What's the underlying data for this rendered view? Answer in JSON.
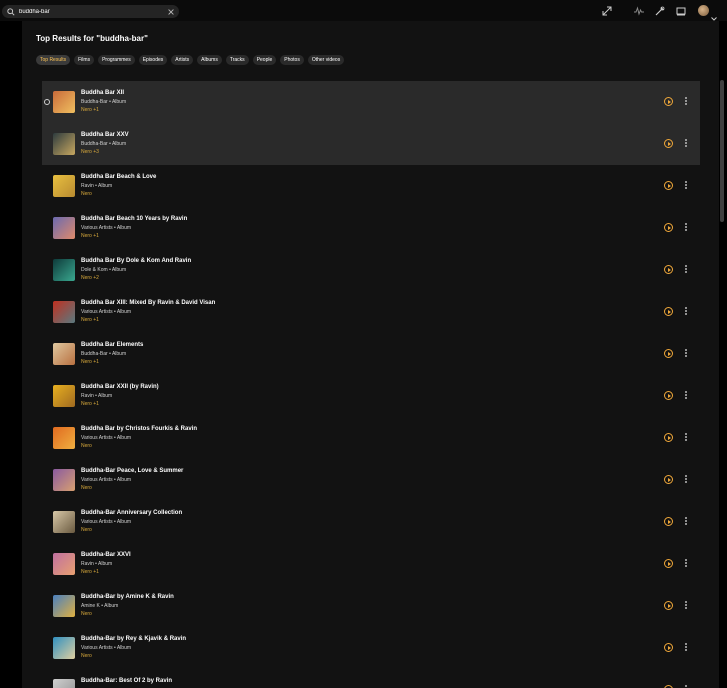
{
  "search": {
    "value": "buddha-bar"
  },
  "heading": "Top Results for \"buddha-bar\"",
  "filters": [
    "Top Results",
    "Films",
    "Programmes",
    "Episodes",
    "Artists",
    "Albums",
    "Tracks",
    "People",
    "Photos",
    "Other videos"
  ],
  "active_filter": "Top Results",
  "colors": {
    "accent": "#f0a83a",
    "meta": "#d8a93c",
    "background": "#121212",
    "highlight": "#2a2a2a"
  },
  "icons": {
    "search": "search-icon",
    "clear": "clear-icon",
    "expand": "expand-icon",
    "activity": "activity-icon",
    "tools": "tools-icon",
    "cast": "cast-icon",
    "play": "play-icon",
    "more": "more-icon"
  },
  "results": [
    {
      "title": "Buddha Bar XII",
      "subtitle": "Buddha-Bar • Album",
      "meta": "Nero +1",
      "thumb": [
        "#c86a3a",
        "#f0c060"
      ]
    },
    {
      "title": "Buddha Bar XXV",
      "subtitle": "Buddha-Bar • Album",
      "meta": "Nero +3",
      "thumb": [
        "#2e3b3e",
        "#c8a860"
      ]
    },
    {
      "title": "Buddha Bar Beach & Love",
      "subtitle": "Ravin • Album",
      "meta": "Nero",
      "thumb": [
        "#e8c040",
        "#b88a30"
      ]
    },
    {
      "title": "Buddha Bar Beach 10 Years by Ravin",
      "subtitle": "Various Artists • Album",
      "meta": "Nero +1",
      "thumb": [
        "#6a6ab0",
        "#e08a6a"
      ]
    },
    {
      "title": "Buddha Bar By Dole & Kom And Ravin",
      "subtitle": "Dole & Kom • Album",
      "meta": "Nero +2",
      "thumb": [
        "#0e3a3a",
        "#3aa890"
      ]
    },
    {
      "title": "Buddha Bar XIII: Mixed By Ravin & David Visan",
      "subtitle": "Various Artists • Album",
      "meta": "Nero +1",
      "thumb": [
        "#c03020",
        "#5a7a80"
      ]
    },
    {
      "title": "Buddha Bar Elements",
      "subtitle": "Buddha-Bar • Album",
      "meta": "Nero +1",
      "thumb": [
        "#e0c8a0",
        "#b87040"
      ]
    },
    {
      "title": "Buddha Bar XXII (by Ravin)",
      "subtitle": "Ravin • Album",
      "meta": "Nero +1",
      "thumb": [
        "#e8b020",
        "#a06a20"
      ]
    },
    {
      "title": "Buddha Bar by Christos Fourkis & Ravin",
      "subtitle": "Various Artists • Album",
      "meta": "Nero",
      "thumb": [
        "#e06a20",
        "#f0b040"
      ]
    },
    {
      "title": "Buddha-Bar Peace, Love & Summer",
      "subtitle": "Various Artists • Album",
      "meta": "Nero",
      "thumb": [
        "#8a5aa0",
        "#d8a070"
      ]
    },
    {
      "title": "Buddha-Bar Anniversary Collection",
      "subtitle": "Various Artists • Album",
      "meta": "Nero",
      "thumb": [
        "#d8c8a8",
        "#6a5a40"
      ]
    },
    {
      "title": "Buddha-Bar XXVI",
      "subtitle": "Ravin • Album",
      "meta": "Nero +1",
      "thumb": [
        "#c070a0",
        "#e8a070"
      ]
    },
    {
      "title": "Buddha-Bar by Amine K & Ravin",
      "subtitle": "Amine K • Album",
      "meta": "Nero",
      "thumb": [
        "#4a80c0",
        "#e0b040"
      ]
    },
    {
      "title": "Buddha-Bar by Rey & Kjavik & Ravin",
      "subtitle": "Various Artists • Album",
      "meta": "Nero",
      "thumb": [
        "#3090c0",
        "#e0d0a0"
      ]
    },
    {
      "title": "Buddha-Bar: Best Of 2 by Ravin",
      "subtitle": "",
      "meta": "",
      "thumb": [
        "#d0d0d0",
        "#909090"
      ]
    }
  ]
}
